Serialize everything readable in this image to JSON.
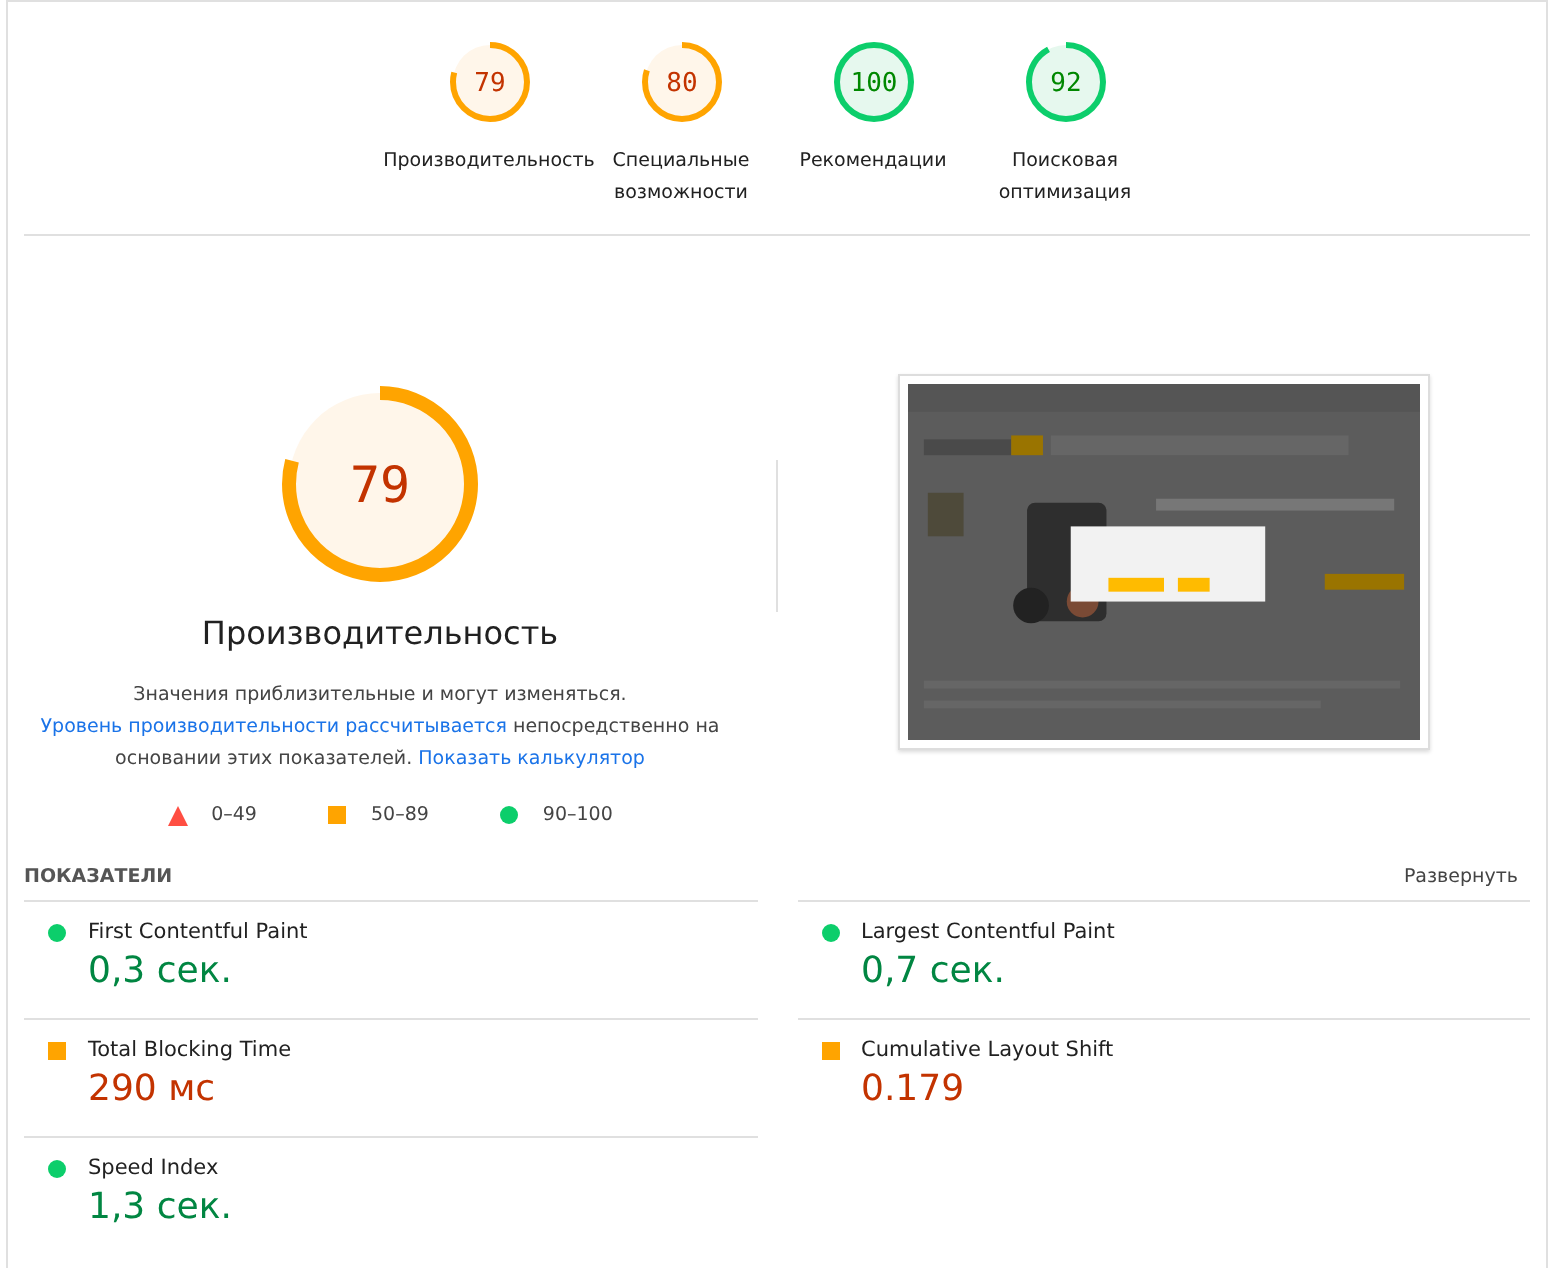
{
  "categories": [
    {
      "score": "79",
      "level": 0.79,
      "kind": "average",
      "label": "Производительность"
    },
    {
      "score": "80",
      "level": 0.8,
      "kind": "average",
      "label": "Специальные возможности"
    },
    {
      "score": "100",
      "level": 1.0,
      "kind": "pass",
      "label": "Рекомендации"
    },
    {
      "score": "92",
      "level": 0.92,
      "kind": "pass",
      "label": "Поисковая оптимизация"
    }
  ],
  "performance": {
    "score": "79",
    "level": 0.79,
    "kind": "average",
    "title": "Производительность",
    "description": [
      {
        "kind": "text",
        "text": "Значения приблизительные и могут изменяться. "
      },
      {
        "kind": "link",
        "text": "Уровень производительности рассчитывается"
      },
      {
        "kind": "text",
        "text": " непосредственно на основании этих показателей. "
      },
      {
        "kind": "link",
        "text": "Показать калькулятор"
      }
    ],
    "legend": [
      {
        "kind": "fail",
        "range": "0–49"
      },
      {
        "kind": "average",
        "range": "50–89"
      },
      {
        "kind": "pass",
        "range": "90–100"
      }
    ]
  },
  "metrics": {
    "heading": "ПОКАЗАТЕЛИ",
    "expand": "Развернуть",
    "items": [
      {
        "name": "First Contentful Paint",
        "value": "0,3 сек.",
        "kind": "pass"
      },
      {
        "name": "Largest Contentful Paint",
        "value": "0,7 сек.",
        "kind": "pass"
      },
      {
        "name": "Total Blocking Time",
        "value": "290 мс",
        "kind": "average"
      },
      {
        "name": "Cumulative Layout Shift",
        "value": "0.179",
        "kind": "average"
      },
      {
        "name": "Speed Index",
        "value": "1,3 сек.",
        "kind": "pass"
      }
    ]
  }
}
